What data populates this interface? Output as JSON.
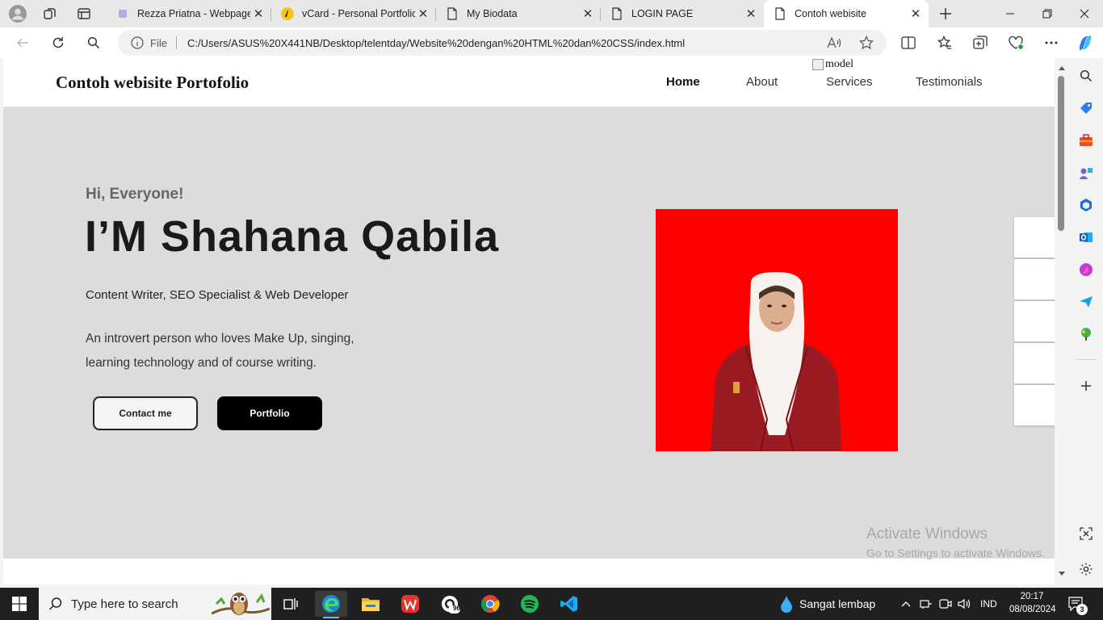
{
  "browser": {
    "tabs": [
      {
        "title": "Rezza Priatna - Webpage",
        "icon": "page-purple-icon"
      },
      {
        "title": "vCard - Personal Portfolio",
        "icon": "vcard-icon"
      },
      {
        "title": "My Biodata",
        "icon": "document-icon"
      },
      {
        "title": "LOGIN PAGE",
        "icon": "document-icon"
      },
      {
        "title": "Contoh webisite",
        "icon": "document-icon",
        "active": true
      }
    ],
    "address": {
      "scheme_label": "File",
      "url": "C:/Users/ASUS%20X441NB/Desktop/telentday/Website%20dengan%20HTML%20dan%20CSS/index.html"
    }
  },
  "site": {
    "logo": "Contoh webisite Portofolio",
    "broken_image_alt": "model",
    "nav": [
      "Home",
      "About",
      "Services",
      "Testimonials"
    ],
    "hero": {
      "greeting": "Hi, Everyone!",
      "name": "I’M Shahana Qabila",
      "roles": "Content Writer, SEO Specialist & Web Developer",
      "bio_line1": "An introvert person who loves Make Up, singing,",
      "bio_line2": "learning technology and of course writing.",
      "contact_button": "Contact me",
      "portfolio_button": "Portfolio"
    },
    "photo_bg_color": "#ff0000"
  },
  "windows_watermark": {
    "line1": "Activate Windows",
    "line2": "Go to Settings to activate Windows."
  },
  "taskbar": {
    "search_placeholder": "Type here to search",
    "badge_count": "96",
    "weather": "Sangat lembap",
    "language": "IND",
    "time": "20:17",
    "date": "08/08/2024",
    "notification_count": "3"
  }
}
